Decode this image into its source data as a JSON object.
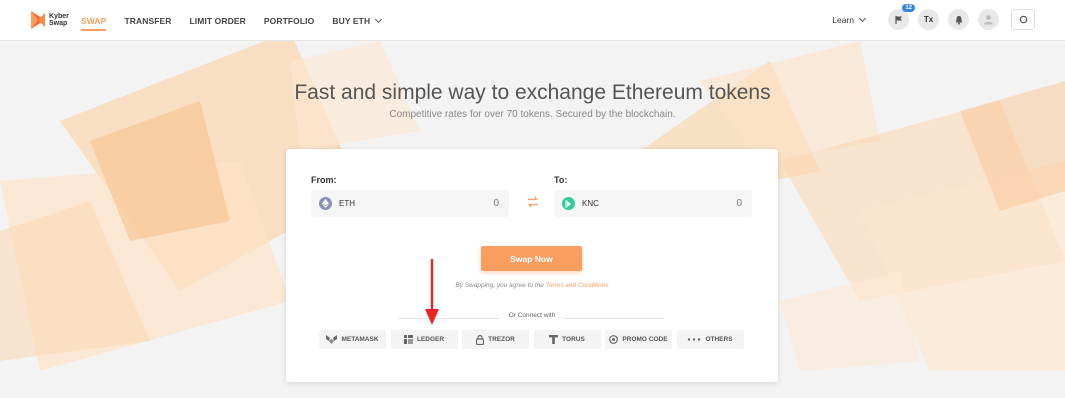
{
  "header": {
    "logo_text_line1": "Kyber",
    "logo_text_line2": "Swap",
    "nav": [
      {
        "label": "SWAP",
        "active": true
      },
      {
        "label": "TRANSFER"
      },
      {
        "label": "LIMIT ORDER"
      },
      {
        "label": "PORTFOLIO"
      },
      {
        "label": "BUY ETH"
      }
    ],
    "learn_label": "Learn",
    "notification_count": "12",
    "tx_label": "Tx"
  },
  "hero": {
    "title": "Fast and simple way to exchange Ethereum tokens",
    "subtitle": "Competitive rates for over 70 tokens. Secured by the blockchain."
  },
  "swap": {
    "from_label": "From:",
    "to_label": "To:",
    "from_token": "ETH",
    "from_amount": "0",
    "to_token": "KNC",
    "to_amount": "0",
    "button_label": "Swap Now",
    "terms_prefix": "By Swapping, you agree to the",
    "terms_link": "Terms and Conditions",
    "or_connect": "Or Connect with"
  },
  "wallets": [
    {
      "label": "METAMASK",
      "icon": "metamask-icon"
    },
    {
      "label": "LEDGER",
      "icon": "ledger-icon"
    },
    {
      "label": "TREZOR",
      "icon": "trezor-icon"
    },
    {
      "label": "TORUS",
      "icon": "torus-icon"
    },
    {
      "label": "PROMO CODE",
      "icon": "promo-code-icon"
    },
    {
      "label": "OTHERS",
      "icon": "more-dots-icon"
    }
  ],
  "colors": {
    "accent": "#fa9e5f",
    "eth": "#8a92b2",
    "knc": "#31cb9e",
    "badge": "#3a86d6"
  }
}
